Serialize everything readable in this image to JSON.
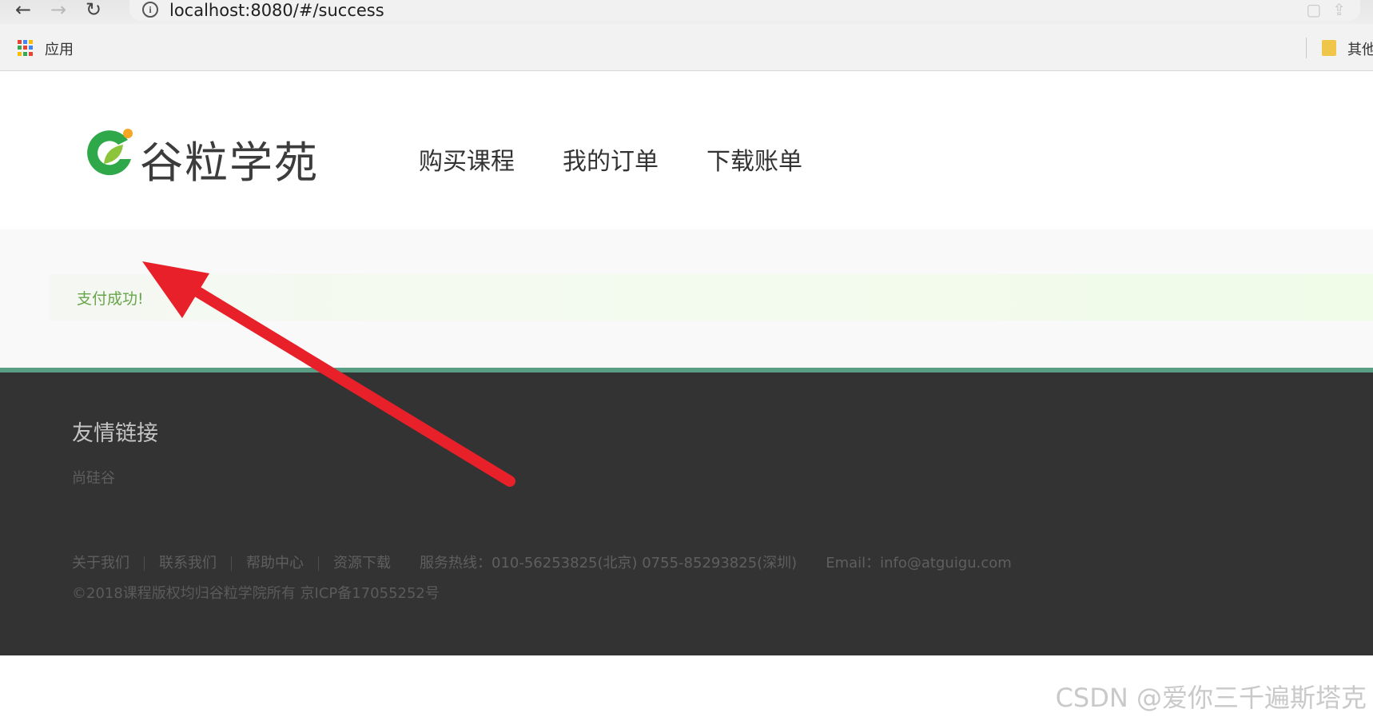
{
  "browser": {
    "url": "localhost:8080/#/success",
    "apps_label": "应用",
    "other_bookmarks_label": "其他",
    "apps_colors": [
      "#e84335",
      "#4285f4",
      "#fbbc05",
      "#34a853",
      "#e84335",
      "#4285f4",
      "#fbbc05",
      "#34a853",
      "#e84335"
    ]
  },
  "header": {
    "logo_text": "谷粒学苑",
    "nav": [
      "购买课程",
      "我的订单",
      "下载账单"
    ]
  },
  "content": {
    "alert_text": "支付成功!"
  },
  "footer": {
    "links_title": "友情链接",
    "friend_link": "尚硅谷",
    "bottom_links": [
      "关于我们",
      "联系我们",
      "帮助中心",
      "资源下载"
    ],
    "hotline": "服务热线：010-56253825(北京) 0755-85293825(深圳)",
    "email": "Email：info@atguigu.com",
    "copyright": "©2018课程版权均归谷粒学院所有 京ICP备17055252号"
  },
  "watermark": "CSDN @爱你三千遍斯塔克",
  "colors": {
    "accent_green": "#67a54a",
    "footer_bg": "#333333",
    "footer_line": "#5a9d85",
    "annotation_arrow": "#e8202a"
  }
}
